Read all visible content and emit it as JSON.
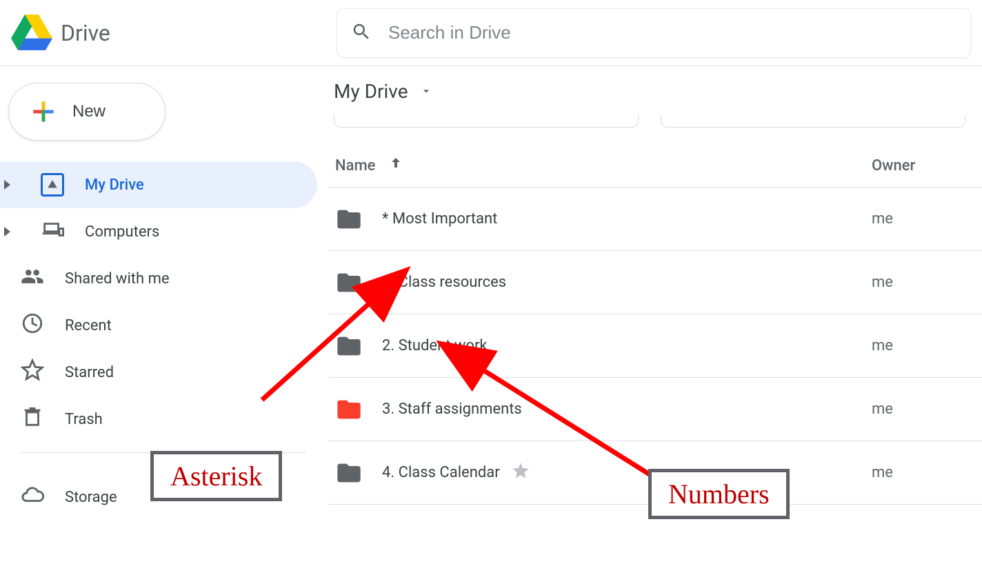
{
  "header": {
    "app_title": "Drive",
    "search_placeholder": "Search in Drive"
  },
  "sidebar": {
    "new_label": "New",
    "items": [
      {
        "label": "My Drive",
        "has_caret": true,
        "active": true,
        "icon": "mydrive"
      },
      {
        "label": "Computers",
        "has_caret": true,
        "active": false,
        "icon": "computers"
      },
      {
        "label": "Shared with me",
        "has_caret": false,
        "active": false,
        "icon": "shared"
      },
      {
        "label": "Recent",
        "has_caret": false,
        "active": false,
        "icon": "recent"
      },
      {
        "label": "Starred",
        "has_caret": false,
        "active": false,
        "icon": "starred"
      },
      {
        "label": "Trash",
        "has_caret": false,
        "active": false,
        "icon": "trash"
      }
    ],
    "storage_label": "Storage"
  },
  "main": {
    "breadcrumb": "My Drive",
    "columns": {
      "name": "Name",
      "owner": "Owner"
    },
    "rows": [
      {
        "name": "* Most Important",
        "owner": "me",
        "folder_color": "#5f6368",
        "starred": false
      },
      {
        "name": "1. Class resources",
        "owner": "me",
        "folder_color": "#5f6368",
        "starred": false
      },
      {
        "name": "2. Student work",
        "owner": "me",
        "folder_color": "#5f6368",
        "starred": false
      },
      {
        "name": "3. Staff assignments",
        "owner": "me",
        "folder_color": "#fa3e2c",
        "starred": false
      },
      {
        "name": "4. Class Calendar",
        "owner": "me",
        "folder_color": "#5f6368",
        "starred": true
      }
    ]
  },
  "annotations": {
    "asterisk_label": "Asterisk",
    "numbers_label": "Numbers"
  }
}
